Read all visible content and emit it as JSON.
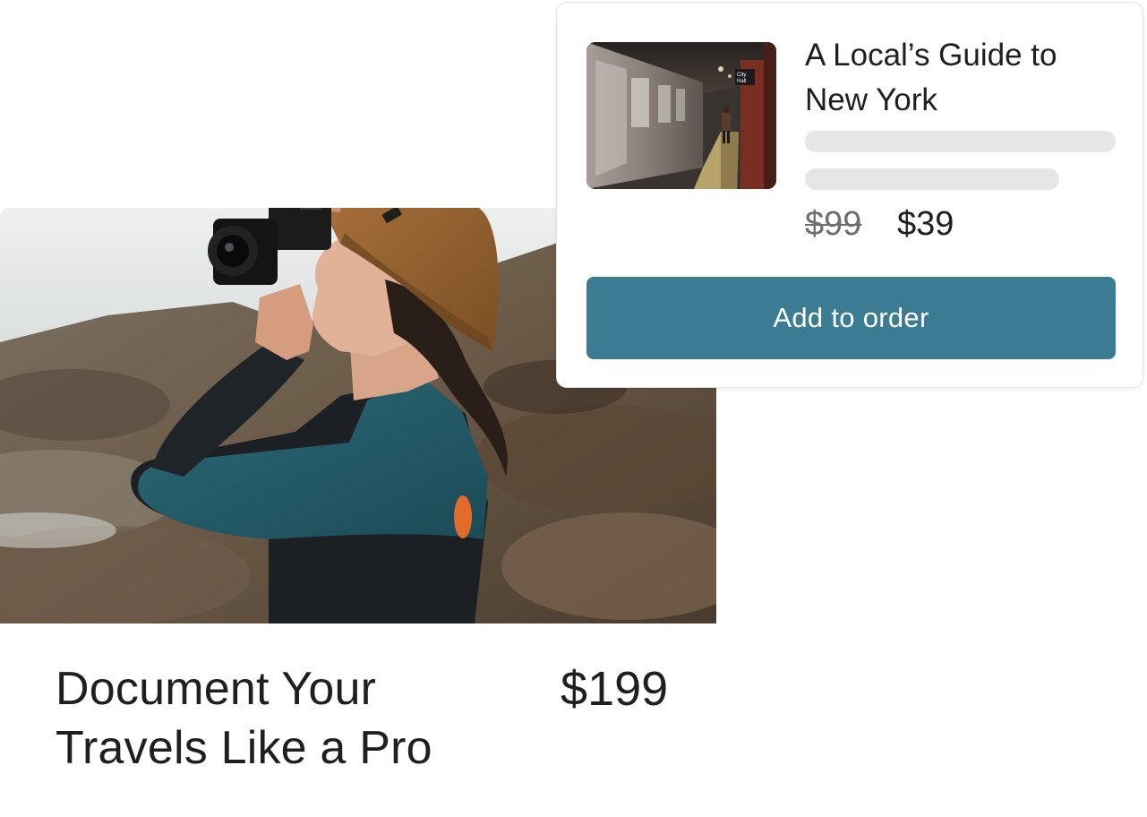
{
  "course": {
    "title": "Document Your Travels Like a Pro",
    "price": "$199",
    "image_alt": "photographer-with-camera"
  },
  "upsell": {
    "title": "A Local’s Guide to New York",
    "original_price": "$99",
    "sale_price": "$39",
    "button_label": "Add to order",
    "thumbnail_alt": "subway-platform",
    "sign_text": "City Hall"
  },
  "colors": {
    "accent": "#3b7c93",
    "placeholder": "#e6e6e6",
    "text": "#1f1f1f",
    "muted": "#6e6e6e"
  }
}
